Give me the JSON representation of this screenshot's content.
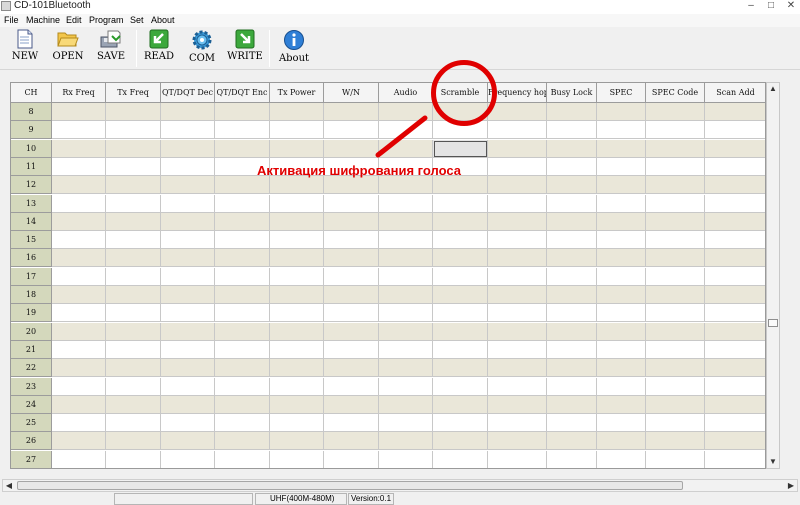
{
  "window": {
    "title": "CD-101Bluetooth",
    "controls": [
      "–",
      "□",
      "✕"
    ]
  },
  "menu": [
    "File",
    "Machine",
    "Edit",
    "Program",
    "Set",
    "About"
  ],
  "toolbar": {
    "new": "NEW",
    "open": "OPEN",
    "save": "SAVE",
    "read": "READ",
    "com": "COM",
    "write": "WRITE",
    "about": "About"
  },
  "grid": {
    "columns": [
      "CH",
      "Rx Freq",
      "Tx Freq",
      "QT/DQT Dec",
      "QT/DQT Enc",
      "Tx Power",
      "W/N",
      "Audio",
      "Scramble",
      "Frequency hop",
      "Busy Lock",
      "SPEC",
      "SPEC Code",
      "Scan Add"
    ],
    "rows": [
      "8",
      "9",
      "10",
      "11",
      "12",
      "13",
      "14",
      "15",
      "16",
      "17",
      "18",
      "19",
      "20",
      "21",
      "22",
      "23",
      "24",
      "25",
      "26",
      "27"
    ],
    "selected_cell": {
      "row": "10",
      "column": "Scramble"
    }
  },
  "status": {
    "band": "UHF(400M-480M)",
    "version": "Version:0.1"
  },
  "annotation": {
    "text": "Активация шифрования голоса",
    "color": "#e00000"
  }
}
